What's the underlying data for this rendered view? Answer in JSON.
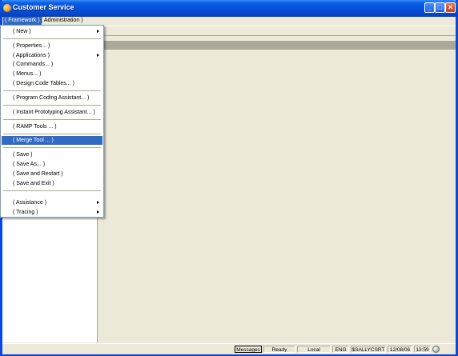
{
  "window": {
    "title": "Customer Service",
    "controls": {
      "minimize": "_",
      "maximize": "□",
      "close": "✕"
    },
    "icon": "app-orb-icon"
  },
  "menubar": {
    "items": [
      "( Framework )",
      "( Administration )"
    ]
  },
  "dropdown": {
    "items": [
      {
        "label": "( New )",
        "submenu": true
      },
      {
        "label": "( Properties... )"
      },
      {
        "label": "( Applications )",
        "submenu": true
      },
      {
        "label": "( Commands... )"
      },
      {
        "label": "( Menus... )"
      },
      {
        "label": "( Design Code Tables... )"
      },
      {
        "label": "( Program Coding Assistant... )"
      },
      {
        "label": "( Instant Prototyping Assistant... )"
      },
      {
        "label": "( RAMP Tools ... )"
      },
      {
        "label": "( Merge Tool ... )",
        "highlighted": true
      },
      {
        "label": "( Save )"
      },
      {
        "label": "( Save As... )"
      },
      {
        "label": "( Save and Restart )"
      },
      {
        "label": "( Save and Exit )"
      },
      {
        "label": "( Assistance )",
        "submenu": true
      },
      {
        "label": "( Tracing )",
        "submenu": true
      }
    ]
  },
  "statusbar": {
    "messages_button": "Messages",
    "status": "Ready",
    "location": "Local",
    "language": "ENG",
    "user": "$SALLYCSRT",
    "date": "12/08/06",
    "time": "13:59"
  },
  "colors": {
    "titlebar": "#0651d8",
    "menu_highlight": "#316ac5",
    "window_bg": "#ece9d8",
    "header_strip": "#aca899"
  }
}
